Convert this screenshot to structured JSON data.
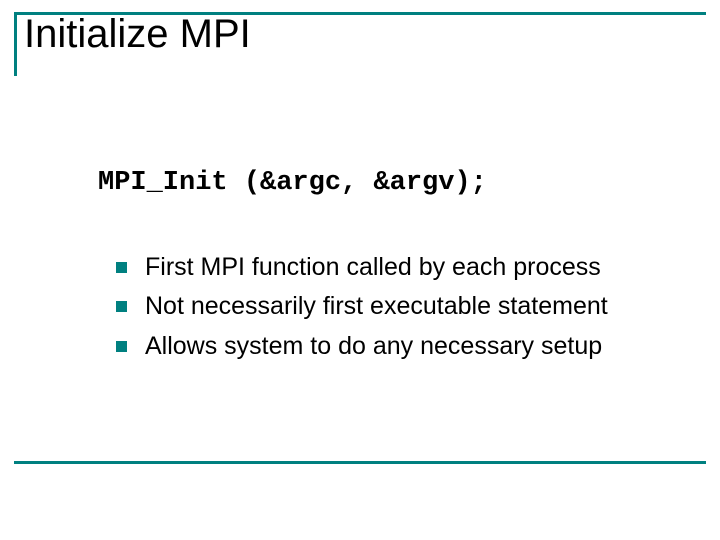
{
  "title": "Initialize MPI",
  "code": "MPI_Init (&argc, &argv);",
  "bullets": [
    "First MPI function called by each process",
    "Not necessarily first executable statement",
    "Allows system to do any necessary setup"
  ]
}
